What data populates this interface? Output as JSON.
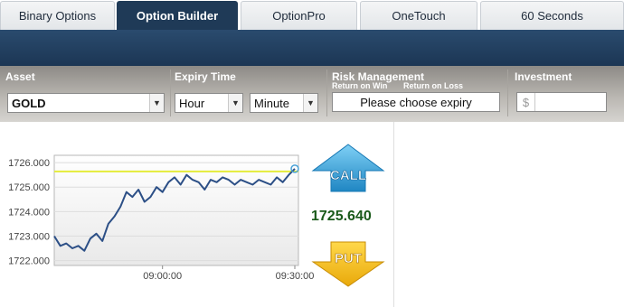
{
  "tabs": [
    {
      "label": "Binary Options"
    },
    {
      "label": "Option Builder"
    },
    {
      "label": "OptionPro"
    },
    {
      "label": "OneTouch"
    },
    {
      "label": "60 Seconds"
    }
  ],
  "active_tab": "Option Builder",
  "controls": {
    "asset_label": "Asset",
    "asset_value": "GOLD",
    "expiry_label": "Expiry Time",
    "expiry_hour": "Hour",
    "expiry_minute": "Minute",
    "risk_label": "Risk Management",
    "return_on_win": "Return on Win",
    "return_on_loss": "Return on Loss",
    "risk_placeholder": "Please choose expiry",
    "investment_label": "Investment",
    "currency_symbol": "$",
    "investment_value": ""
  },
  "trade": {
    "call_label": "CALL",
    "put_label": "PUT",
    "current_price": "1725.640"
  },
  "colors": {
    "call_blue": "#3c9fd6",
    "put_yellow": "#f2bd16",
    "price_green": "#1a5a1a",
    "line": "#2c4f86",
    "strike": "#e4ec3a"
  },
  "chart_data": {
    "type": "line",
    "title": "",
    "xlabel": "",
    "ylabel": "",
    "ylim": [
      1721.8,
      1726.3
    ],
    "y_ticks": [
      "1726.000",
      "1725.000",
      "1724.000",
      "1723.000",
      "1722.000"
    ],
    "x_ticks": [
      "09:00:00",
      "09:30:00"
    ],
    "strike_level": 1725.64,
    "series": [
      {
        "x": [
          0,
          1,
          2,
          3,
          4,
          5,
          6,
          7,
          8,
          9,
          10,
          11,
          12,
          13,
          14,
          15,
          16,
          17,
          18,
          19,
          20,
          21,
          22,
          23,
          24,
          25,
          26,
          27,
          28,
          29,
          30,
          31,
          32,
          33,
          34,
          35,
          36,
          37,
          38,
          39,
          40
        ],
        "values": [
          1723.0,
          1722.6,
          1722.7,
          1722.5,
          1722.6,
          1722.4,
          1722.9,
          1723.1,
          1722.8,
          1723.5,
          1723.8,
          1724.2,
          1724.8,
          1724.6,
          1724.9,
          1724.4,
          1724.6,
          1725.0,
          1724.8,
          1725.2,
          1725.4,
          1725.1,
          1725.5,
          1725.3,
          1725.2,
          1724.9,
          1725.3,
          1725.2,
          1725.4,
          1725.3,
          1725.1,
          1725.3,
          1725.2,
          1725.1,
          1725.3,
          1725.2,
          1725.1,
          1725.4,
          1725.2,
          1725.5,
          1725.75
        ]
      }
    ],
    "x_tick_index": [
      18,
      40
    ]
  }
}
